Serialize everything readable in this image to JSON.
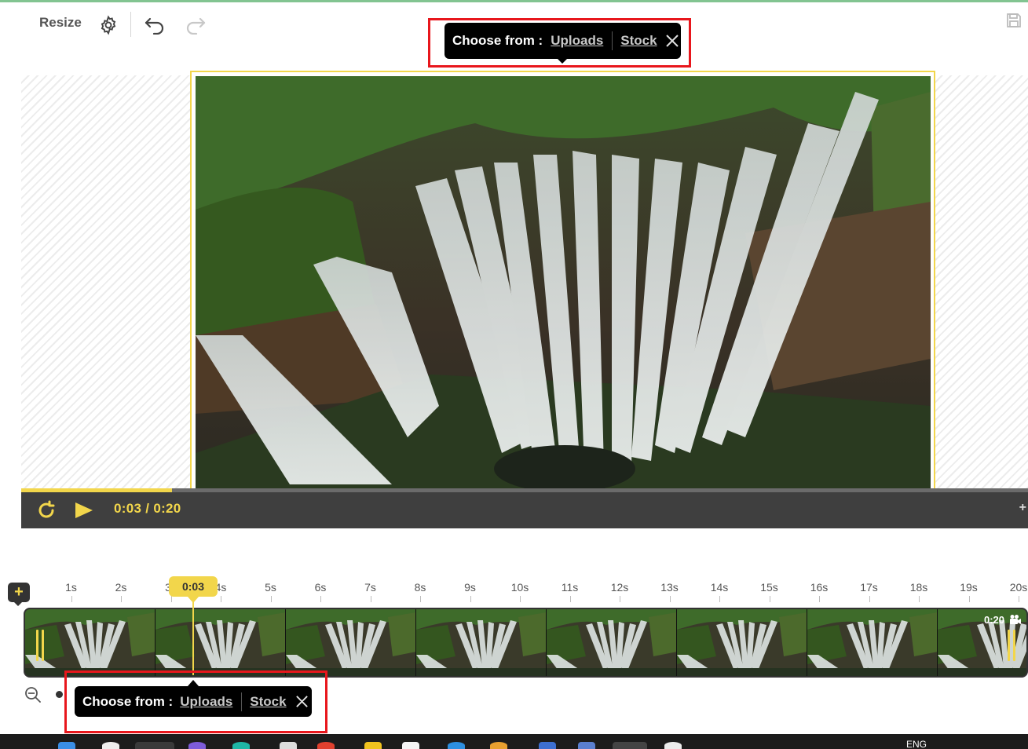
{
  "toolbar": {
    "resize_label": "Resize"
  },
  "choose_popup": {
    "label": "Choose from :",
    "uploads": "Uploads",
    "stock": "Stock"
  },
  "player": {
    "current_time": "0:03",
    "separator": "/",
    "total_time": "0:20",
    "progress_fraction": 0.15
  },
  "timeline": {
    "add_label": "+",
    "ticks": [
      "1s",
      "2s",
      "3s",
      "4s",
      "5s",
      "6s",
      "7s",
      "8s",
      "9s",
      "10s",
      "11s",
      "12s",
      "13s",
      "14s",
      "15s",
      "16s",
      "17s",
      "18s",
      "19s",
      "20s"
    ],
    "playhead_label": "0:03",
    "clip_duration": "0:20",
    "thumbnail_count": 8
  },
  "taskbar": {
    "language": "ENG"
  },
  "colors": {
    "accent": "#f2d64b",
    "highlight": "#e8161c",
    "player_bg": "#3f3f3f",
    "tooltip_bg": "#000000"
  }
}
